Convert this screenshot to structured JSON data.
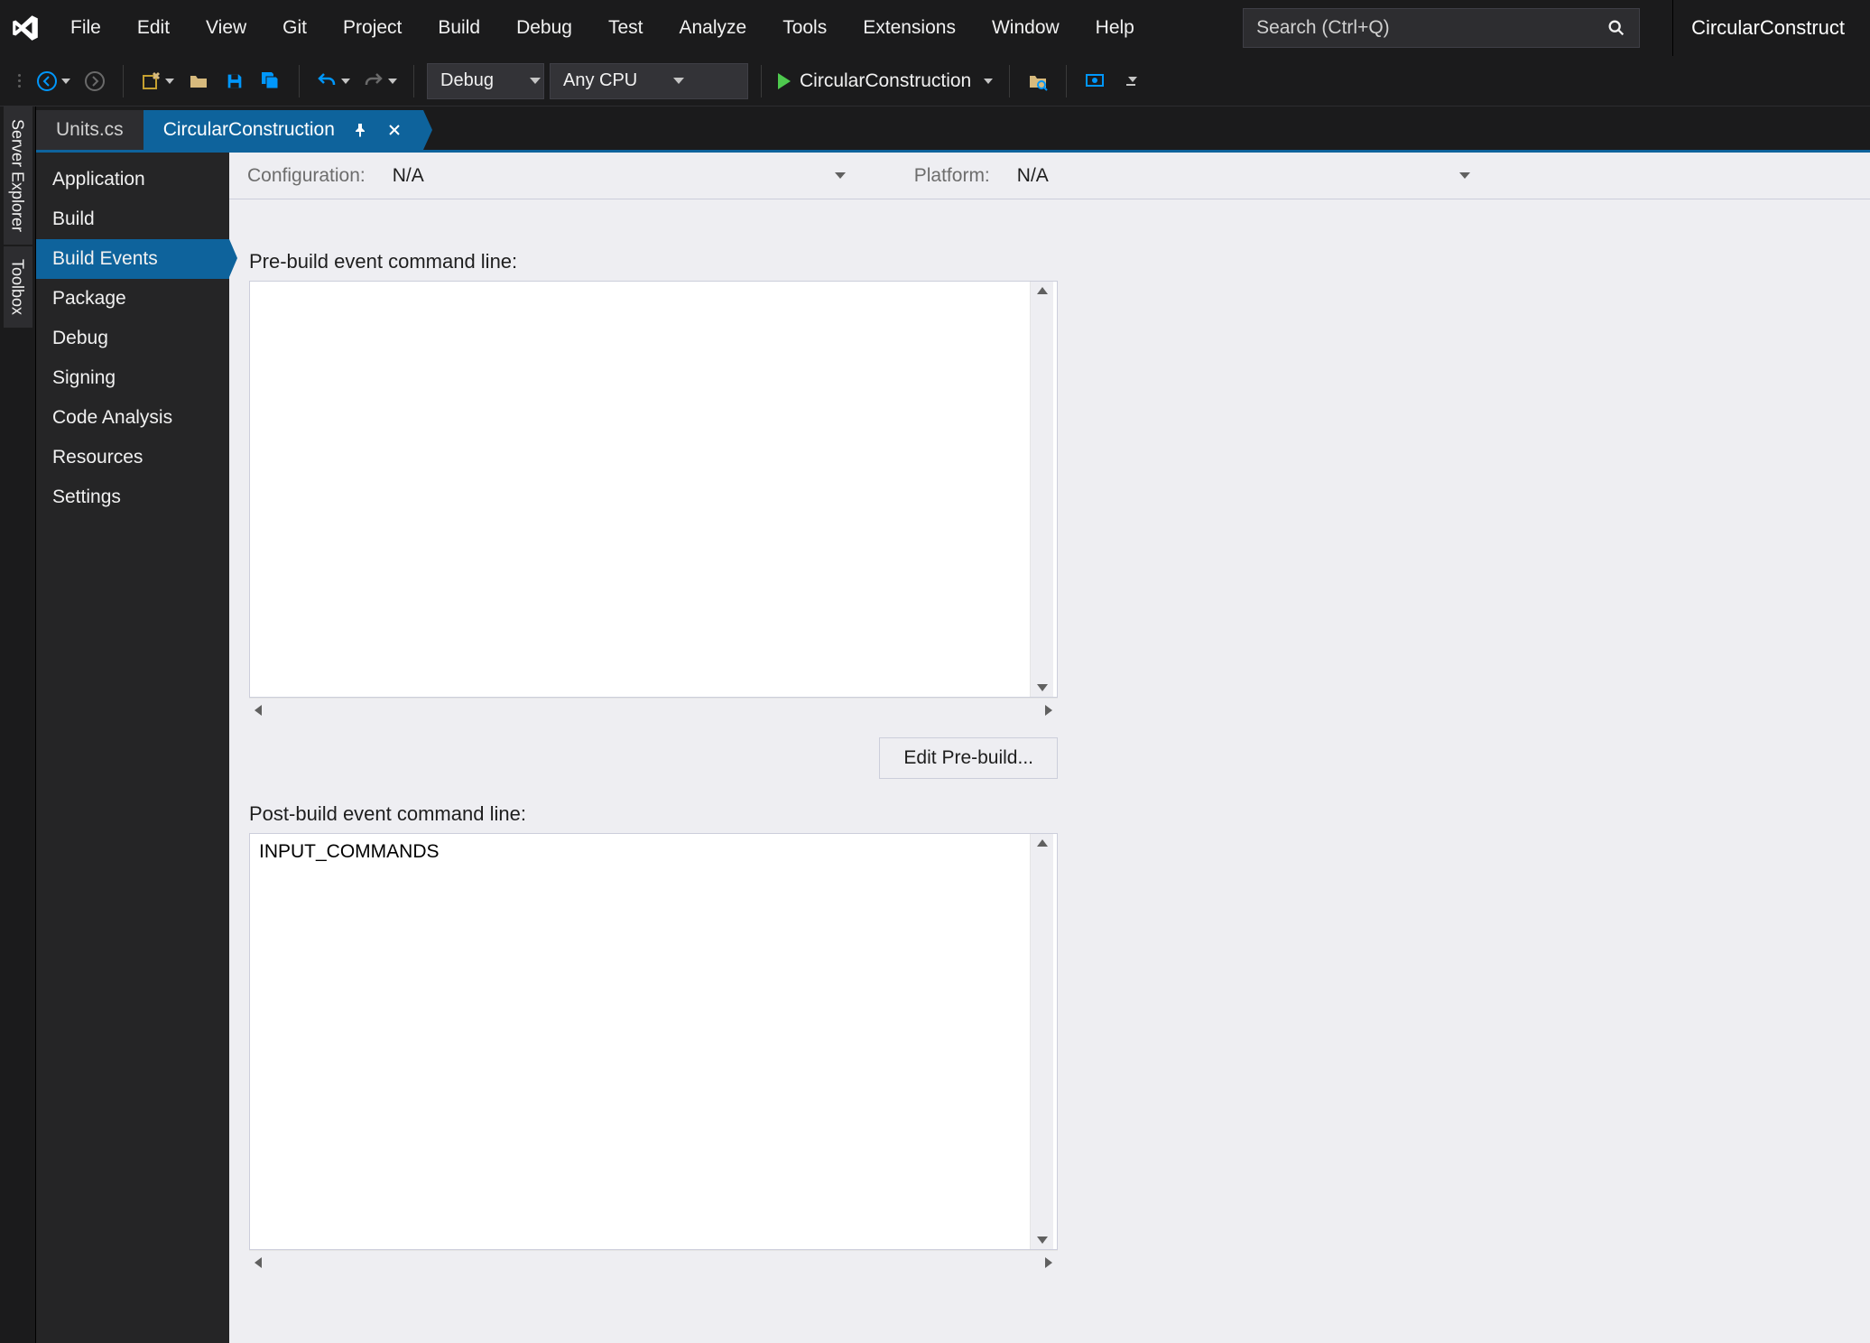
{
  "menu": {
    "items": [
      "File",
      "Edit",
      "View",
      "Git",
      "Project",
      "Build",
      "Debug",
      "Test",
      "Analyze",
      "Tools",
      "Extensions",
      "Window",
      "Help"
    ],
    "search_placeholder": "Search (Ctrl+Q)",
    "solution_name": "CircularConstruct"
  },
  "toolbar": {
    "config_select": "Debug",
    "platform_select": "Any CPU",
    "start_target": "CircularConstruction"
  },
  "side_tabs": [
    "Server Explorer",
    "Toolbox"
  ],
  "doc_tabs": {
    "items": [
      {
        "label": "Units.cs",
        "active": false,
        "pinned": false,
        "closable": false
      },
      {
        "label": "CircularConstruction",
        "active": true,
        "pinned": true,
        "closable": true
      }
    ]
  },
  "prop_nav": {
    "items": [
      "Application",
      "Build",
      "Build Events",
      "Package",
      "Debug",
      "Signing",
      "Code Analysis",
      "Resources",
      "Settings"
    ],
    "selected_index": 2
  },
  "cfg_bar": {
    "config_label": "Configuration:",
    "config_value": "N/A",
    "platform_label": "Platform:",
    "platform_value": "N/A"
  },
  "build_events": {
    "pre_label": "Pre-build event command line:",
    "pre_value": "",
    "edit_pre_label": "Edit Pre-build...",
    "post_label": "Post-build event command line:",
    "post_value": "INPUT_COMMANDS"
  }
}
